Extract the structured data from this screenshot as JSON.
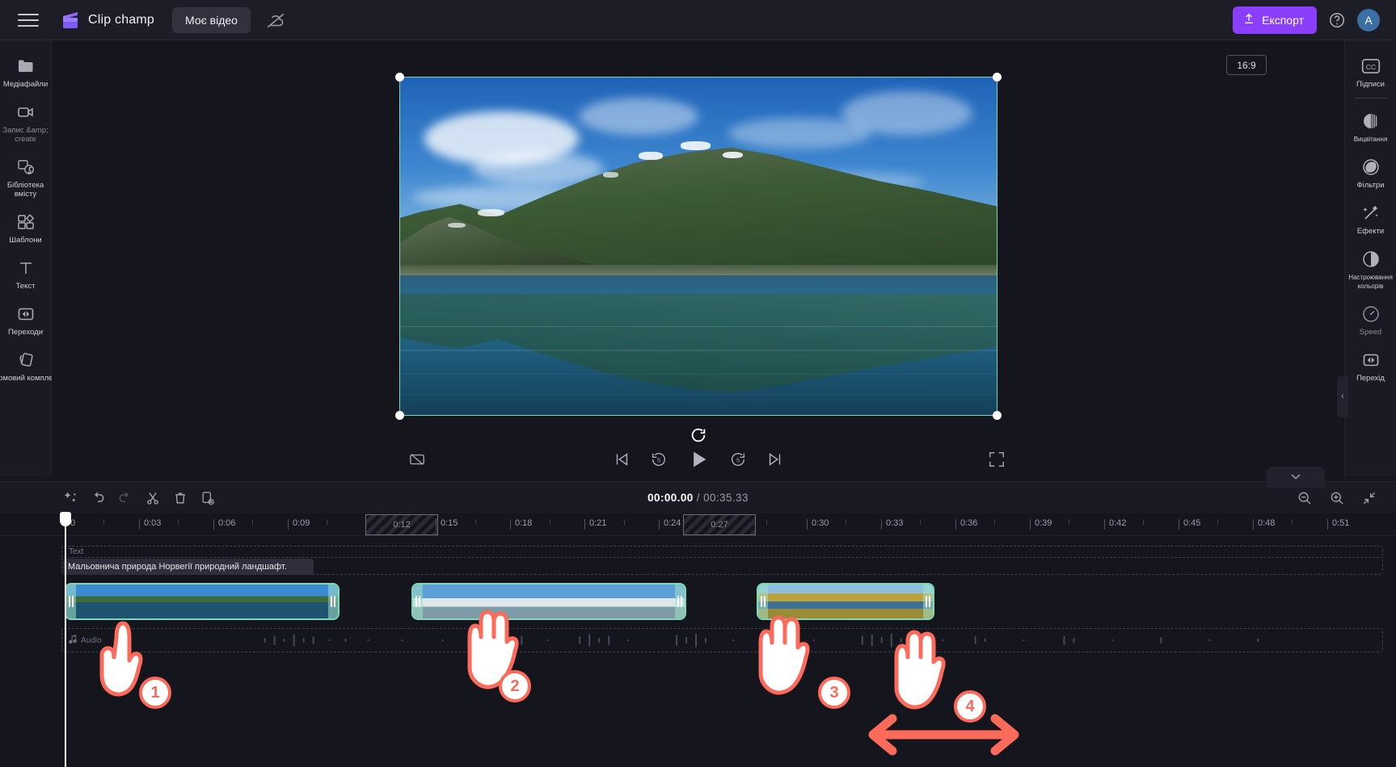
{
  "app": {
    "brand": "Clip champ",
    "project_button": "Моє відео",
    "export_button": "Експорт",
    "avatar_initial": "A",
    "icons": {
      "menu": "hamburger-menu-icon",
      "cloud_off": "cloud-offline-icon",
      "help": "help-question-icon",
      "export": "upload-arrow-icon"
    }
  },
  "left_rail": {
    "items": [
      {
        "label": "Медіафайли",
        "icon": "folder-icon",
        "dim": false
      },
      {
        "label": "Запис &amp; create",
        "icon": "video-camera-icon",
        "dim": true
      },
      {
        "label": "Бібліотека вмісту",
        "icon": "content-library-icon",
        "dim": false
      },
      {
        "label": "Шаблони",
        "icon": "templates-grid-icon",
        "dim": false
      },
      {
        "label": "Текст",
        "icon": "text-t-icon",
        "dim": false
      },
      {
        "label": "Переходи",
        "icon": "transitions-icon",
        "dim": false
      },
      {
        "label": "Фірмовий комплект",
        "icon": "brand-kit-icon",
        "dim": false
      }
    ]
  },
  "right_rail": {
    "items": [
      {
        "label": "Підписи",
        "icon": "closed-caption-icon",
        "dim": false,
        "separator_after": true
      },
      {
        "label": "Вицвітання",
        "icon": "fade-icon",
        "dim": false,
        "separator_after": false
      },
      {
        "label": "Фільтри",
        "icon": "filters-icon",
        "dim": false,
        "separator_after": false
      },
      {
        "label": "Ефекти",
        "icon": "effects-wand-icon",
        "dim": false,
        "separator_after": false
      },
      {
        "label": "Настроювання кольорів",
        "icon": "color-adjust-icon",
        "dim": false,
        "separator_after": false
      },
      {
        "label": "Speed",
        "icon": "speed-gauge-icon",
        "dim": true,
        "separator_after": false
      },
      {
        "label": "Перехід",
        "icon": "transition-icon",
        "dim": false,
        "separator_after": false
      }
    ]
  },
  "preview": {
    "aspect_ratio": "16:9",
    "controls": {
      "captions_off": "captions-off-icon",
      "skip_start": "skip-to-start-icon",
      "back5": "rewind-5s-icon",
      "play": "play-icon",
      "forward5": "forward-5s-icon",
      "skip_end": "skip-to-end-icon",
      "fullscreen": "fullscreen-icon",
      "reload": "reload-icon"
    },
    "selection_color": "#7fd9b4"
  },
  "timeline": {
    "toolbar": {
      "magic": "magic-sparkle-icon",
      "undo": "undo-icon",
      "redo": "redo-icon",
      "split": "scissors-split-icon",
      "delete": "trash-delete-icon",
      "duplicate": "duplicate-icon",
      "zoom_out": "zoom-out-icon",
      "zoom_in": "zoom-in-icon",
      "fit": "fit-to-screen-icon"
    },
    "current_time": "00:00.00",
    "separator": " / ",
    "total_time": "00:35.33",
    "ruler_labels": [
      "0",
      "0:03",
      "0:06",
      "0:09",
      "0:12",
      "0:15",
      "0:18",
      "0:21",
      "0:24",
      "0:27",
      "0:30",
      "0:33",
      "0:36",
      "0:39",
      "0:42",
      "0:45",
      "0:48",
      "0:51"
    ],
    "hatched_markers": [
      "0:12",
      "0:27"
    ],
    "text_track": {
      "clip_label": "Мальовнича природа Норвегії природний ландшафт.",
      "upper_label": "Text"
    },
    "audio_track": {
      "label": "Audio",
      "icon": "music-note-icon"
    },
    "video_clips": [
      {
        "name": "clip-1",
        "scene": "fjord-green"
      },
      {
        "name": "clip-2",
        "scene": "snow-mountain"
      },
      {
        "name": "clip-3",
        "scene": "golden-island"
      }
    ]
  },
  "annotations": {
    "steps": [
      {
        "number": "1",
        "kind": "pointer-hand"
      },
      {
        "number": "2",
        "kind": "grab-hand"
      },
      {
        "number": "3",
        "kind": "grab-hand"
      },
      {
        "number": "4",
        "kind": "grab-hand"
      }
    ],
    "arrow": "double-headed-horizontal-arrow",
    "accent_color": "#fb6a5a"
  }
}
